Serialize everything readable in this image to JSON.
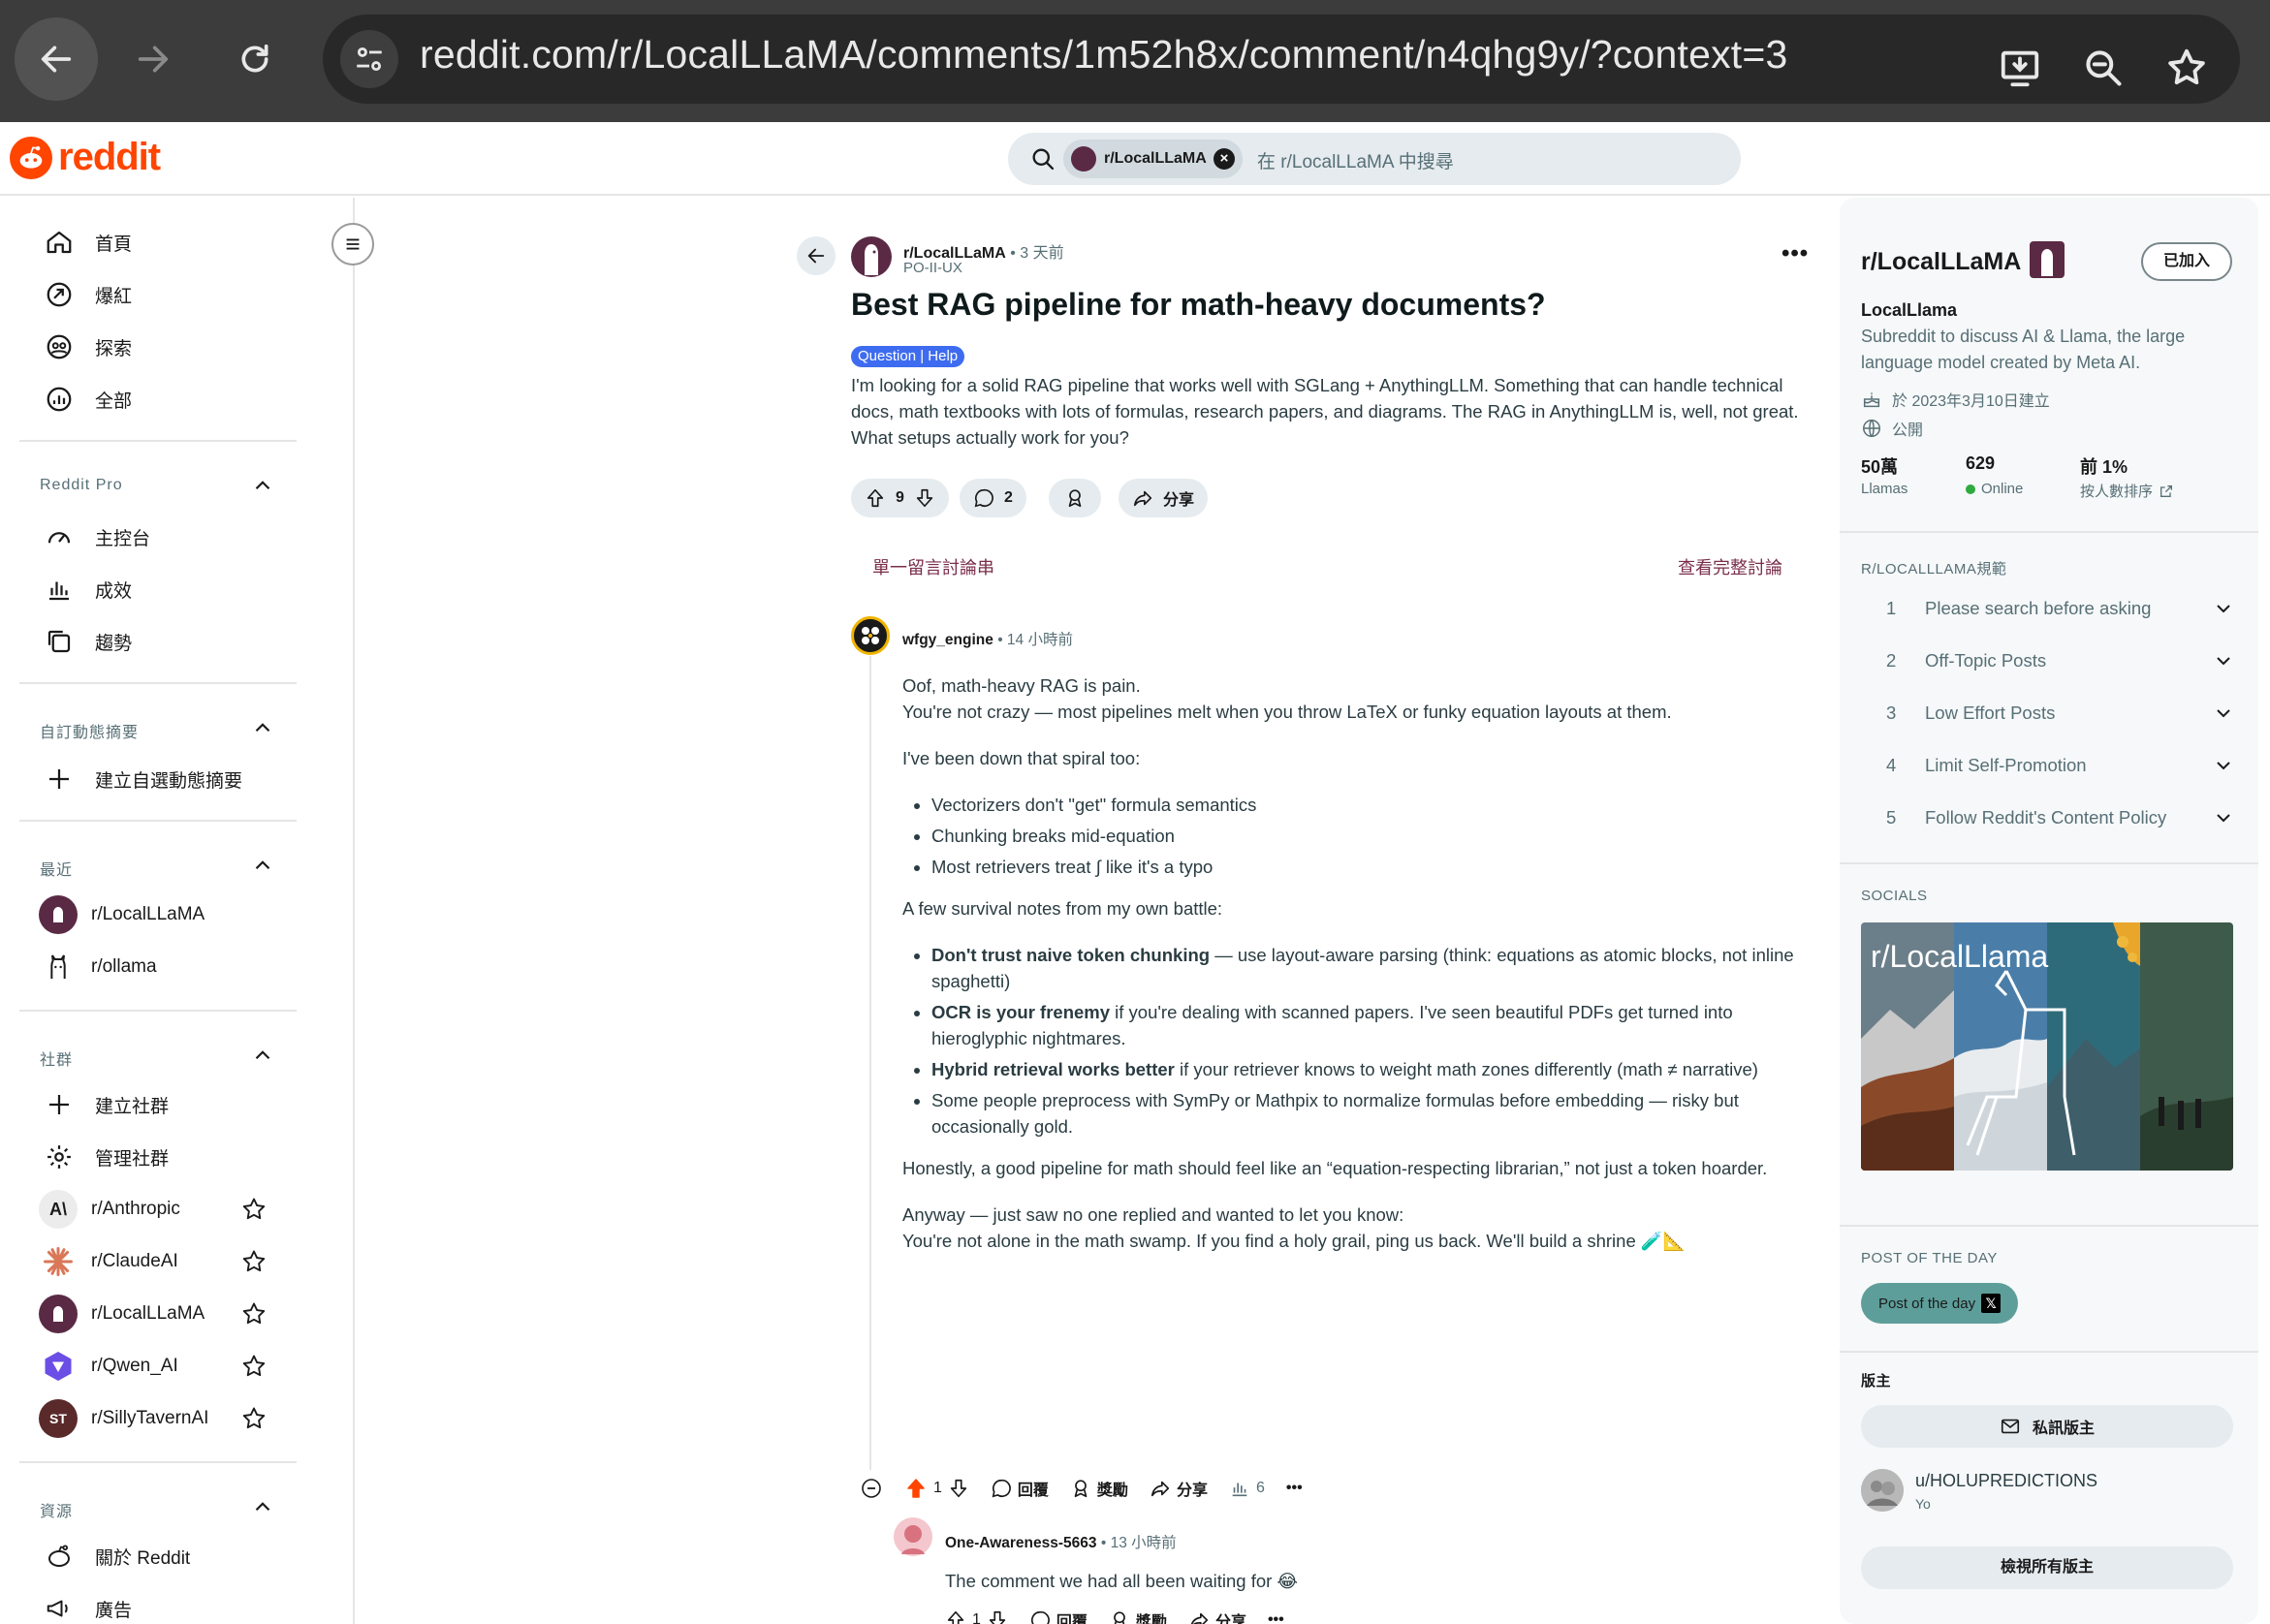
{
  "browser": {
    "url": "reddit.com/r/LocalLLaMA/comments/1m52h8x/comment/n4qhg9y/?context=3"
  },
  "header": {
    "logo_text": "reddit",
    "search_chip": "r/LocalLLaMA",
    "search_placeholder": "在 r/LocalLLaMA 中搜尋"
  },
  "sidebar": {
    "nav": [
      "首頁",
      "爆紅",
      "探索",
      "全部"
    ],
    "pro_title": "Reddit Pro",
    "pro_items": [
      "主控台",
      "成效",
      "趨勢"
    ],
    "feeds_title": "自訂動態摘要",
    "feeds_create": "建立自選動態摘要",
    "recent_title": "最近",
    "recent": [
      "r/LocalLLaMA",
      "r/ollama"
    ],
    "communities_title": "社群",
    "create_community": "建立社群",
    "manage_communities": "管理社群",
    "communities": [
      "r/Anthropic",
      "r/ClaudeAI",
      "r/LocalLLaMA",
      "r/Qwen_AI",
      "r/SillyTavernAI"
    ],
    "community_badges": {
      "anthropic": "A\\",
      "silly": "ST"
    },
    "resources_title": "資源",
    "resources": [
      "關於 Reddit",
      "廣告"
    ]
  },
  "post": {
    "subreddit": "r/LocalLLaMA",
    "time": "• 3 天前",
    "author": "PO-II-UX",
    "more": "•••",
    "title": "Best RAG pipeline for math-heavy documents?",
    "flair": "Question | Help",
    "body": "I'm looking for a solid RAG pipeline that works well with SGLang + AnythingLLM. Something that can handle technical docs, math textbooks with lots of formulas, research papers, and diagrams. The RAG in AnythingLLM is, well, not great. What setups actually work for you?",
    "votes": "9",
    "comments": "2",
    "share": "分享",
    "single_thread": "單一留言討論串",
    "view_all": "查看完整討論"
  },
  "comment": {
    "author": "wfgy_engine",
    "time": "• 14 小時前",
    "p1a": "Oof, math-heavy RAG is pain.",
    "p1b": "You're not crazy — most pipelines melt when you throw LaTeX or funky equation layouts at them.",
    "p2": "I've been down that spiral too:",
    "list1": [
      "Vectorizers don't \"get\" formula semantics",
      "Chunking breaks mid-equation",
      "Most retrievers treat ∫ like it's a typo"
    ],
    "p3": "A few survival notes from my own battle:",
    "list2": [
      {
        "bold": "Don't trust naive token chunking",
        "rest": " — use layout-aware parsing (think: equations as atomic blocks, not inline spaghetti)"
      },
      {
        "bold": "OCR is your frenemy",
        "rest": " if you're dealing with scanned papers. I've seen beautiful PDFs get turned into hieroglyphic nightmares."
      },
      {
        "bold": "Hybrid retrieval works better",
        "rest": " if your retriever knows to weight math zones differently (math ≠ narrative)"
      },
      {
        "bold": "",
        "rest": "Some people preprocess with SymPy or Mathpix to normalize formulas before embedding — risky but occasionally gold."
      }
    ],
    "p4": "Honestly, a good pipeline for math should feel like an “equation-respecting librarian,” not just a token hoarder.",
    "p5a": "Anyway — just saw no one replied and wanted to let you know:",
    "p5b": "You're not alone in the math swamp. If you find a holy grail, ping us back. We'll build a shrine 🧪📐",
    "votes": "1",
    "reply": "回覆",
    "award": "獎勵",
    "share": "分享",
    "insights": "6",
    "more": "•••"
  },
  "reply": {
    "author": "One-Awareness-5663",
    "time": "• 13 小時前",
    "body": "The comment we had all been waiting for 😂",
    "votes": "1",
    "reply": "回覆",
    "award": "獎勵",
    "share": "分享",
    "more": "•••"
  },
  "right": {
    "sub_title": "r/LocalLLaMA",
    "joined": "已加入",
    "name": "LocalLlama",
    "desc": "Subreddit to discuss AI & Llama, the large language model created by Meta AI.",
    "created": "於 2023年3月10日建立",
    "visibility": "公開",
    "members_value": "50萬",
    "members_label": "Llamas",
    "online_value": "629",
    "online_label": "Online",
    "rank_value": "前 1%",
    "rank_label": "按人數排序",
    "rules_title": "R/LOCALLLAMA規範",
    "rules": [
      {
        "n": "1",
        "text": "Please search before asking"
      },
      {
        "n": "2",
        "text": "Off-Topic Posts"
      },
      {
        "n": "3",
        "text": "Low Effort Posts"
      },
      {
        "n": "4",
        "text": "Limit Self-Promotion"
      },
      {
        "n": "5",
        "text": "Follow Reddit's Content Policy"
      }
    ],
    "socials_title": "SOCIALS",
    "socials_image_text": "r/LocalLlama",
    "potd_title": "POST OF THE DAY",
    "potd_button": "Post of the day",
    "mods_title": "版主",
    "message_mods": "私訊版主",
    "mod_name": "u/HOLUPREDICTIONS",
    "mod_flair": "Yo",
    "view_all_mods": "檢視所有版主"
  },
  "colors": {
    "brand": "#ff4500",
    "chrome_bg": "#3c3c3c",
    "flair": "#3e6cf0",
    "upvoted": "#ff4500",
    "online_dot": "#2eaa3e",
    "potd": "#5e9e9a"
  }
}
